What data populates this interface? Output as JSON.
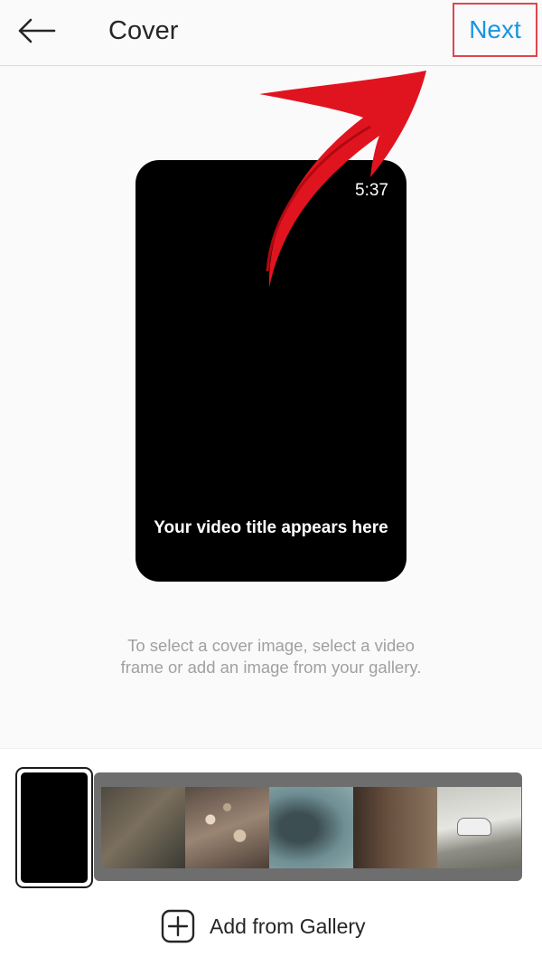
{
  "header": {
    "title": "Cover",
    "next_label": "Next",
    "back_icon": "arrow-left-icon"
  },
  "preview": {
    "duration": "5:37",
    "video_title": "Your video title appears here"
  },
  "hint": "To select a cover image, select a video frame or add an image from your gallery.",
  "filmstrip": {
    "frames": [
      "frame-1",
      "frame-2",
      "frame-3",
      "frame-4",
      "frame-5"
    ]
  },
  "gallery": {
    "label": "Add from Gallery",
    "icon": "plus-square-icon"
  },
  "colors": {
    "accent_blue": "#1b94e0",
    "annotation_red": "#e0141f",
    "highlight_border": "#e0454d"
  }
}
